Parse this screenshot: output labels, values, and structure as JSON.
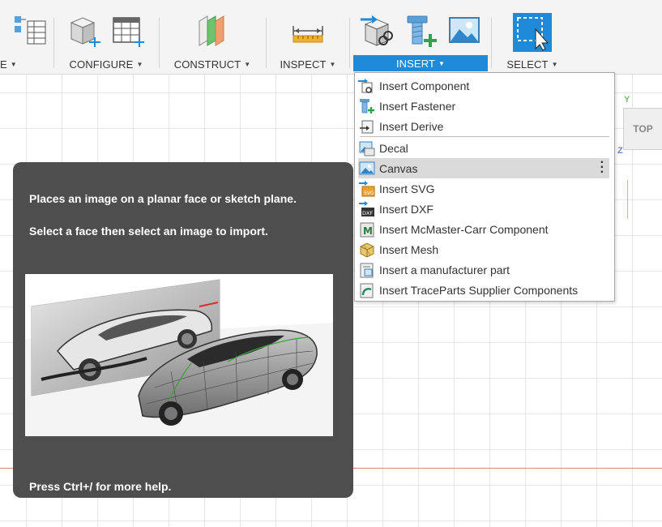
{
  "toolbar": {
    "groups": [
      {
        "label": "E"
      },
      {
        "label": "CONFIGURE"
      },
      {
        "label": "CONSTRUCT"
      },
      {
        "label": "INSPECT"
      },
      {
        "label": "INSERT"
      },
      {
        "label": "SELECT"
      }
    ]
  },
  "insert_menu": {
    "items": [
      {
        "label": "Insert Component",
        "icon": "insert-component-icon"
      },
      {
        "label": "Insert Fastener",
        "icon": "fastener-icon"
      },
      {
        "label": "Insert Derive",
        "icon": "derive-icon"
      },
      {
        "label": "Decal",
        "icon": "decal-icon"
      },
      {
        "label": "Canvas",
        "icon": "canvas-icon"
      },
      {
        "label": "Insert SVG",
        "icon": "svg-icon"
      },
      {
        "label": "Insert DXF",
        "icon": "dxf-icon"
      },
      {
        "label": "Insert McMaster-Carr Component",
        "icon": "mcmaster-icon"
      },
      {
        "label": "Insert Mesh",
        "icon": "mesh-icon"
      },
      {
        "label": "Insert a manufacturer part",
        "icon": "manufacturer-part-icon"
      },
      {
        "label": "Insert TraceParts Supplier Components",
        "icon": "traceparts-icon"
      }
    ]
  },
  "tooltip": {
    "description": "Places an image on a planar face or sketch plane.",
    "instruction": "Select a face then select an image to import.",
    "help": "Press Ctrl+/ for more help."
  },
  "viewcube": {
    "face": "TOP",
    "axis_y": "Y",
    "axis_z": "Z"
  },
  "colors": {
    "accent": "#1f8bd8",
    "tooltip_bg": "#4e4e4e",
    "menu_hover": "#dadada"
  }
}
